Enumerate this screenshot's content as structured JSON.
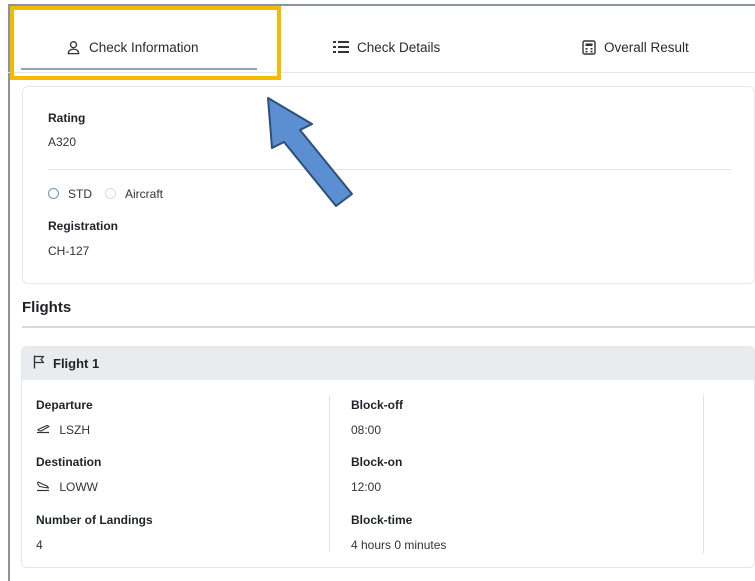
{
  "tabs": [
    {
      "label": "Check Information",
      "icon": "user-icon",
      "active": true
    },
    {
      "label": "Check Details",
      "icon": "list-icon"
    },
    {
      "label": "Overall Result",
      "icon": "calculator-icon"
    }
  ],
  "colors": {
    "highlight": "#f7b900",
    "arrow": "#5b8fd1",
    "active_underline": "#8fa6b8",
    "radio_selected": "#6b97b9"
  },
  "check_info": {
    "rating_label": "Rating",
    "rating_value": "A320",
    "radio_options": [
      {
        "label": "STD",
        "selected": true
      },
      {
        "label": "Aircraft",
        "selected": false
      }
    ],
    "registration_label": "Registration",
    "registration_value": "CH-127"
  },
  "flights": {
    "section_title": "Flights",
    "items": [
      {
        "title": "Flight 1",
        "departure_label": "Departure",
        "departure_value": "LSZH",
        "destination_label": "Destination",
        "destination_value": "LOWW",
        "landings_label": "Number of Landings",
        "landings_value": "4",
        "block_off_label": "Block-off",
        "block_off_value": "08:00",
        "block_on_label": "Block-on",
        "block_on_value": "12:00",
        "block_time_label": "Block-time",
        "block_time_value": "4 hours 0 minutes"
      }
    ]
  }
}
